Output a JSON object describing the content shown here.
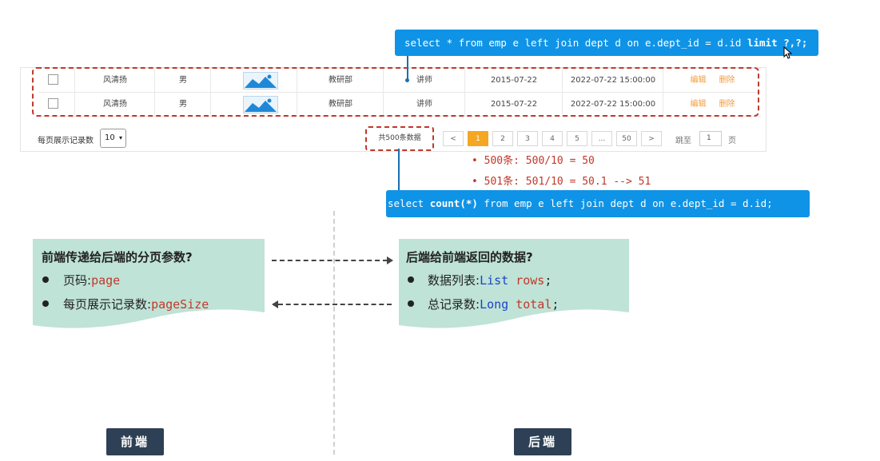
{
  "table": {
    "rows": [
      {
        "name": "风清扬",
        "gender": "男",
        "dept": "教研部",
        "job": "讲师",
        "entry_date": "2015-07-22",
        "update_time": "2022-07-22 15:00:00",
        "edit": "编辑",
        "delete": "删除"
      },
      {
        "name": "风清扬",
        "gender": "男",
        "dept": "教研部",
        "job": "讲师",
        "entry_date": "2015-07-22",
        "update_time": "2022-07-22 15:00:00",
        "edit": "编辑",
        "delete": "删除"
      }
    ]
  },
  "pagination": {
    "page_size_label": "每页展示记录数",
    "page_size_value": "10",
    "total_text": "共500条数据",
    "prev": "<",
    "pages": [
      "1",
      "2",
      "3",
      "4",
      "5",
      "...",
      "50"
    ],
    "active_page": "1",
    "next": ">",
    "jump_label": "跳至",
    "jump_value": "1",
    "page_unit": "页"
  },
  "sql": {
    "top_prefix": "select * from emp e left join dept d on e.dept_id = d.id ",
    "top_keyword": "limit ?,?;",
    "bottom_prefix": "select ",
    "bottom_keyword": "count(*)",
    "bottom_suffix": " from emp e left join dept d on e.dept_id = d.id;"
  },
  "calc": {
    "line1": "• 500条: 500/10 = 50",
    "line2": "• 501条: 501/10 = 50.1 --> 51"
  },
  "frontend_card": {
    "title": "前端传递给后端的分页参数?",
    "item1_label": "页码:",
    "item1_code": "page",
    "item2_label": "每页展示记录数:",
    "item2_code": "pageSize"
  },
  "backend_card": {
    "title": "后端给前端返回的数据?",
    "item1_label": "数据列表:",
    "item1_type": "List",
    "item1_var": "rows",
    "item1_end": ";",
    "item2_label": "总记录数:",
    "item2_type": "Long",
    "item2_var": "total",
    "item2_end": ";"
  },
  "labels": {
    "frontend": "前端",
    "backend": "后端"
  },
  "colors": {
    "sql_bg": "#0f93e6",
    "card_bg": "#bfe3d6",
    "accent_red": "#c0392b",
    "page_active": "#f5a623",
    "tag_bg": "#2d4055"
  }
}
